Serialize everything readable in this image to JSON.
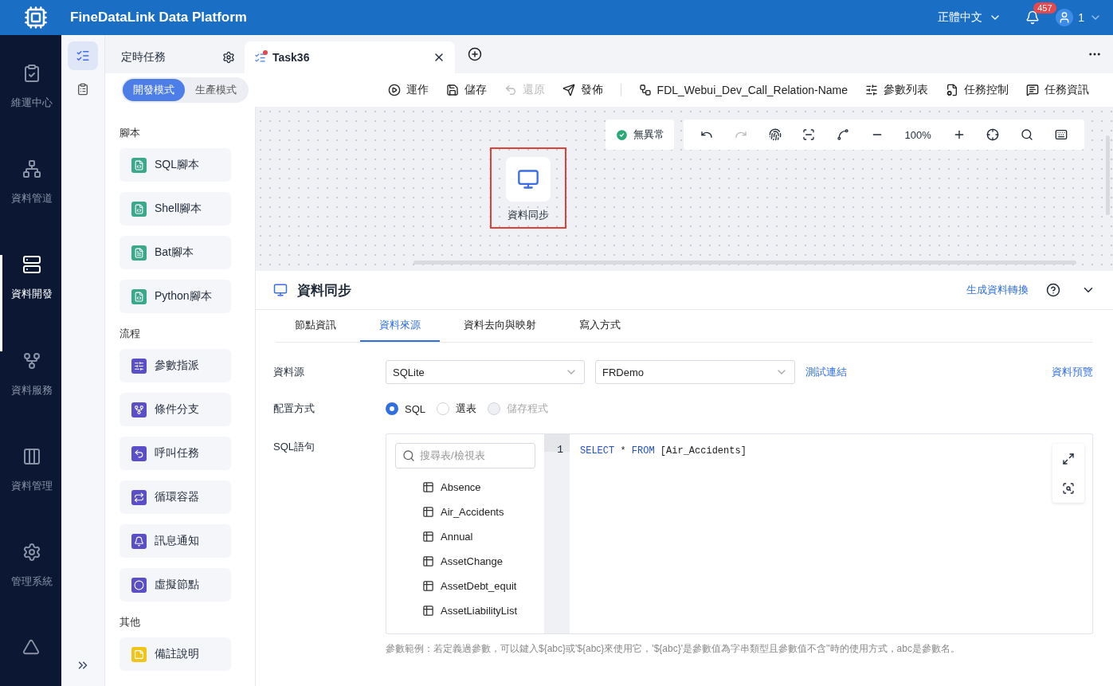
{
  "header": {
    "title": "FineDataLink Data Platform",
    "language": "正體中文",
    "notification_count": "457",
    "user": "1"
  },
  "nav": [
    {
      "label": "維運中心",
      "selected": false
    },
    {
      "label": "資料管道",
      "selected": false
    },
    {
      "label": "資料開發",
      "selected": true
    },
    {
      "label": "資料服務",
      "selected": false
    },
    {
      "label": "資料管理",
      "selected": false
    },
    {
      "label": "管理系統",
      "selected": false
    }
  ],
  "subnav": [
    {
      "selected": true
    },
    {
      "selected": false
    }
  ],
  "tabs": [
    {
      "label": "定時任務",
      "kind": "folder",
      "selected": false
    },
    {
      "label": "Task36",
      "kind": "task",
      "selected": true
    }
  ],
  "modes": [
    {
      "label": "開發模式",
      "selected": true
    },
    {
      "label": "生產模式",
      "selected": false
    }
  ],
  "toolbar": [
    {
      "label": "運作",
      "disabled": false
    },
    {
      "label": "儲存",
      "disabled": false
    },
    {
      "label": "還原",
      "disabled": true
    },
    {
      "label": "發佈",
      "disabled": false
    },
    {
      "label": "FDL_Webui_Dev_Call_Relation-Name",
      "disabled": false
    },
    {
      "label": "參數列表",
      "disabled": false
    },
    {
      "label": "任務控制",
      "disabled": false
    },
    {
      "label": "任務資訊",
      "disabled": false
    }
  ],
  "components": [
    {
      "section": "腳本",
      "items": [
        {
          "label": "SQL腳本",
          "color": "#3aa88a"
        },
        {
          "label": "Shell腳本",
          "color": "#3aa88a"
        },
        {
          "label": "Bat腳本",
          "color": "#3aa88a"
        },
        {
          "label": "Python腳本",
          "color": "#3aa88a"
        }
      ]
    },
    {
      "section": "流程",
      "items": [
        {
          "label": "參數指派",
          "color": "#5b4fc9"
        },
        {
          "label": "條件分支",
          "color": "#5b4fc9"
        },
        {
          "label": "呼叫任務",
          "color": "#5b4fc9"
        },
        {
          "label": "循環容器",
          "color": "#5b4fc9"
        },
        {
          "label": "訊息通知",
          "color": "#5b4fc9"
        },
        {
          "label": "虛擬節點",
          "color": "#5b4fc9"
        }
      ]
    },
    {
      "section": "其他",
      "items": [
        {
          "label": "備註說明",
          "color": "#f0c419"
        }
      ]
    }
  ],
  "canvas": {
    "status": "無異常",
    "zoom": "100%",
    "node": {
      "label": "資料同步",
      "selected": true
    }
  },
  "detail": {
    "title": "資料同步",
    "link": "生成資料轉換",
    "tabs": [
      {
        "label": "節點資訊",
        "selected": false
      },
      {
        "label": "資料來源",
        "selected": true
      },
      {
        "label": "資料去向與映射",
        "selected": false
      },
      {
        "label": "寫入方式",
        "selected": false
      }
    ],
    "source_label": "資料源",
    "source_type": "SQLite",
    "source_db": "FRDemo",
    "test_link": "測試連結",
    "preview_link": "資料預覽",
    "config_label": "配置方式",
    "config_options": [
      {
        "label": "SQL",
        "selected": true,
        "disabled": false
      },
      {
        "label": "選表",
        "selected": false,
        "disabled": false
      },
      {
        "label": "儲存程式",
        "selected": false,
        "disabled": true
      }
    ],
    "sql_label": "SQL語句",
    "search_placeholder": "搜尋表/檢視表",
    "tables": [
      "Absence",
      "Air_Accidents",
      "Annual",
      "AssetChange",
      "AssetDebt_equit",
      "AssetLiabilityList"
    ],
    "line_number": "1",
    "code": [
      {
        "text": "SELECT",
        "kind": "keyword"
      },
      {
        "text": " * ",
        "kind": "plain"
      },
      {
        "text": "FROM",
        "kind": "keyword"
      },
      {
        "text": " [Air_Accidents]",
        "kind": "plain"
      }
    ],
    "hint": "參數範例：若定義過參數，可以鍵入${abc}或'${abc}來使用它，'${abc}'是參數值為字串類型且參數值不含''時的使用方式，abc是參數名。"
  }
}
